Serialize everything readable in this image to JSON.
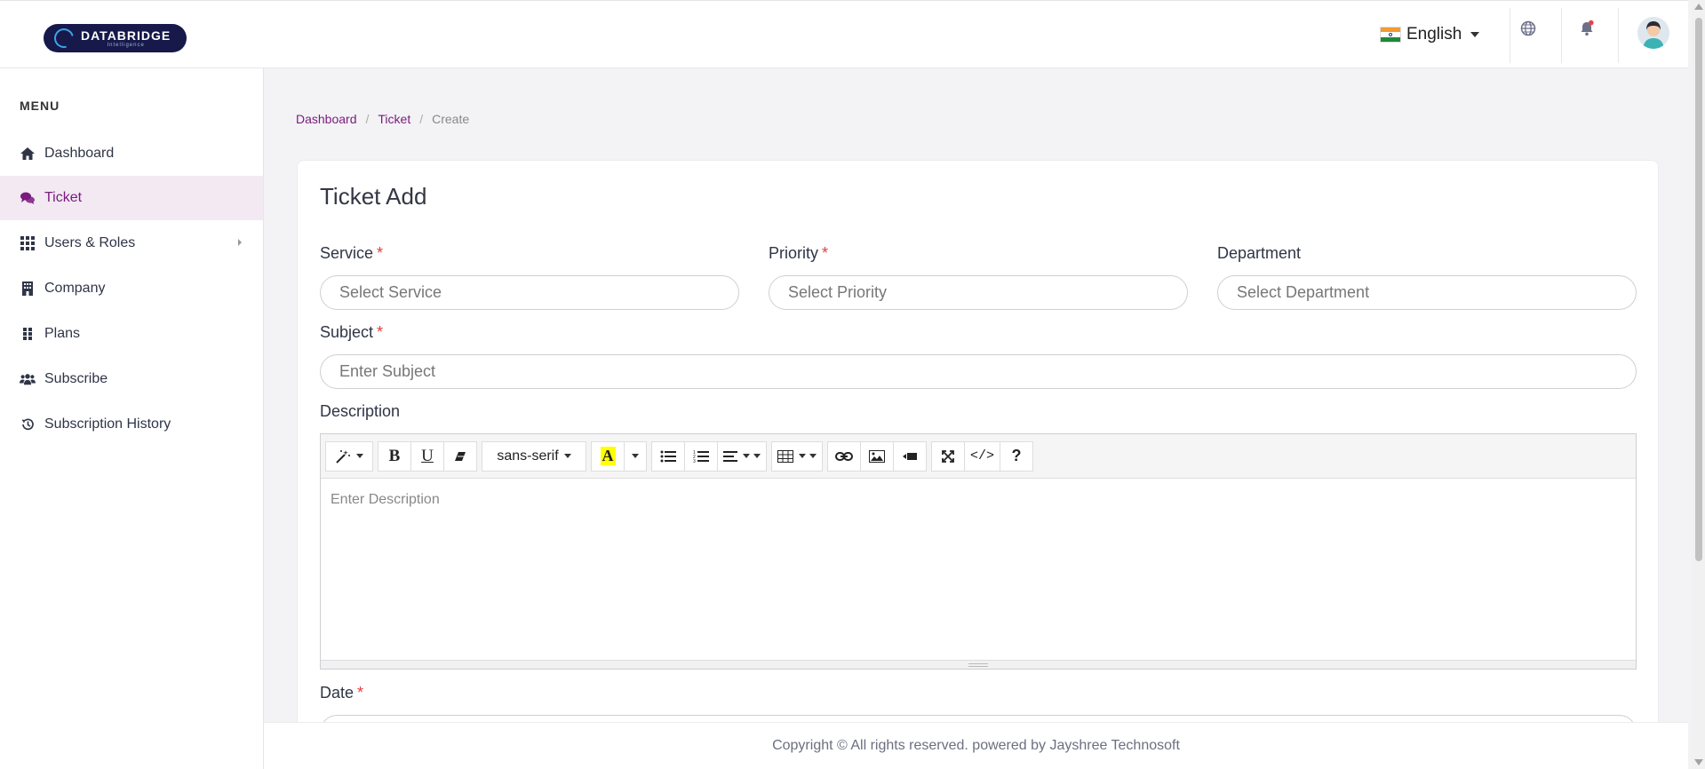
{
  "brand": {
    "title": "DATABRIDGE",
    "subtitle": "Intelligence"
  },
  "header": {
    "language": "English",
    "language_icon": "india-flag-icon",
    "icons": [
      "globe-icon",
      "bell-icon",
      "user-avatar"
    ]
  },
  "sidebar": {
    "menu_title": "MENU",
    "items": [
      {
        "label": "Dashboard",
        "icon": "home-icon"
      },
      {
        "label": "Ticket",
        "icon": "comments-icon",
        "active": true
      },
      {
        "label": "Users & Roles",
        "icon": "grid-icon",
        "has_submenu": true
      },
      {
        "label": "Company",
        "icon": "building-icon"
      },
      {
        "label": "Plans",
        "icon": "dots-grid-icon"
      },
      {
        "label": "Subscribe",
        "icon": "users-icon"
      },
      {
        "label": "Subscription History",
        "icon": "history-icon"
      }
    ]
  },
  "breadcrumb": {
    "items": [
      "Dashboard",
      "Ticket"
    ],
    "current": "Create",
    "separator": "/"
  },
  "form": {
    "title": "Ticket Add",
    "service": {
      "label": "Service",
      "required": "*",
      "placeholder": "Select Service"
    },
    "priority": {
      "label": "Priority",
      "required": "*",
      "placeholder": "Select Priority"
    },
    "department": {
      "label": "Department",
      "placeholder": "Select Department"
    },
    "subject": {
      "label": "Subject",
      "required": "*",
      "placeholder": "Enter Subject"
    },
    "description": {
      "label": "Description",
      "placeholder": "Enter Description",
      "font_family": "sans-serif"
    },
    "date": {
      "label": "Date",
      "required": "*"
    }
  },
  "footer": {
    "text": "Copyright © All rights reserved. powered by Jayshree Technosoft"
  },
  "colors": {
    "accent": "#7a1a7d",
    "required": "#e43b3b",
    "active_bg": "#f2e9f3",
    "brand_bg": "#16194a"
  }
}
